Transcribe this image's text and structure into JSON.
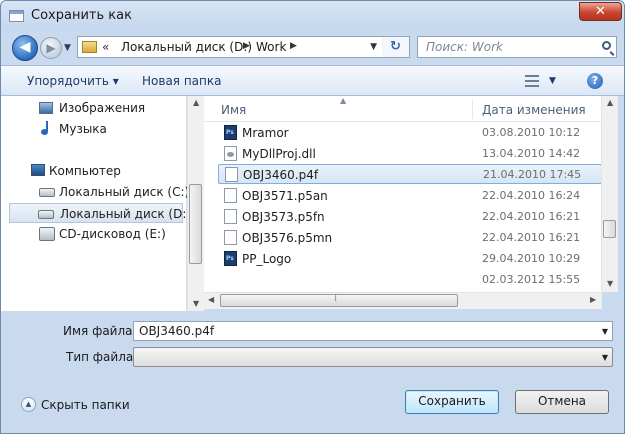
{
  "window": {
    "title": "Сохранить как",
    "close_glyph": "✕"
  },
  "nav": {
    "back_glyph": "◀",
    "forward_glyph": "▶",
    "history_glyph": "▼",
    "address_prefix": "«",
    "breadcrumbs": [
      "Локальный диск (D:)",
      "Work"
    ],
    "crumb_separator": "▶",
    "dropdown_glyph": "▼",
    "refresh_glyph": "↻",
    "search_placeholder": "Поиск: Work"
  },
  "toolbar": {
    "organize_label": "Упорядочить ▾",
    "new_folder_label": "Новая папка",
    "view_dropdown_glyph": "▼",
    "help_glyph": "?"
  },
  "sidebar": {
    "items": [
      {
        "label": "Изображения",
        "icon": "pictures-icon"
      },
      {
        "label": "Музыка",
        "icon": "music-icon"
      },
      {
        "label": "Компьютер",
        "icon": "computer-icon"
      },
      {
        "label": "Локальный диск (C:)",
        "icon": "disk-icon"
      },
      {
        "label": "Локальный диск (D:)",
        "icon": "disk-icon",
        "selected": true
      },
      {
        "label": "CD-дисковод (E:)",
        "icon": "cd-drive-icon"
      }
    ]
  },
  "file_list": {
    "columns": {
      "name": "Имя",
      "date": "Дата изменения"
    },
    "sort_glyph": "▲",
    "rows": [
      {
        "name": "Mramor",
        "date": "03.08.2010 10:12",
        "icon": "photoshop-file-icon"
      },
      {
        "name": "MyDllProj.dll",
        "date": "13.04.2010 14:42",
        "icon": "dll-file-icon"
      },
      {
        "name": "OBJ3460.p4f",
        "date": "21.04.2010 17:45",
        "icon": "blank-file-icon",
        "selected": true
      },
      {
        "name": "OBJ3571.p5an",
        "date": "22.04.2010 16:24",
        "icon": "blank-file-icon"
      },
      {
        "name": "OBJ3573.p5fn",
        "date": "22.04.2010 16:21",
        "icon": "blank-file-icon"
      },
      {
        "name": "OBJ3576.p5mn",
        "date": "22.04.2010 16:21",
        "icon": "blank-file-icon"
      },
      {
        "name": "PP_Logo",
        "date": "29.04.2010 10:29",
        "icon": "photoshop-file-icon"
      },
      {
        "name": "",
        "date": "02.03.2012 15:55",
        "icon": ""
      }
    ]
  },
  "scroll_glyphs": {
    "up": "▲",
    "down": "▼",
    "left": "◀",
    "right": "▶"
  },
  "form": {
    "filename_label": "Имя файла:",
    "filename_value": "OBJ3460.p4f",
    "filetype_label": "Тип файла:",
    "filetype_value": "",
    "dropdown_glyph": "▼"
  },
  "footer": {
    "hide_folders_label": "Скрыть папки",
    "hide_glyph": "▲",
    "save_label": "Сохранить",
    "cancel_label": "Отмена"
  }
}
